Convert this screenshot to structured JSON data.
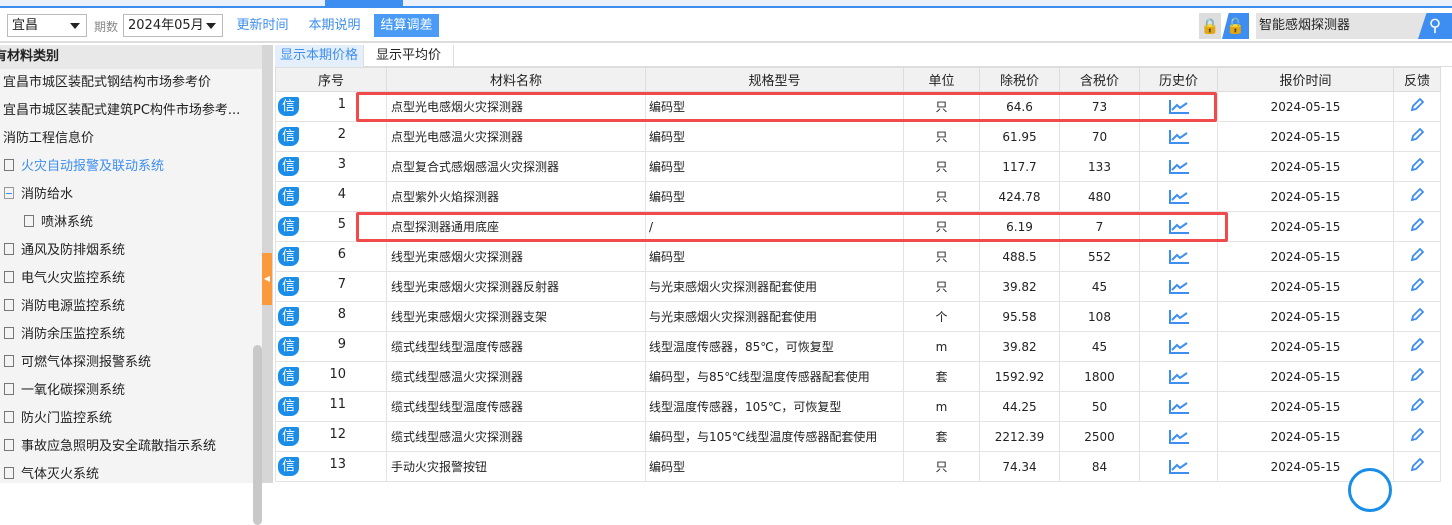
{
  "toolbar": {
    "region": "宜昌",
    "period_label": "期数",
    "period": "2024年05月",
    "buttons": [
      "更新时间",
      "本期说明",
      "结算调差"
    ],
    "search_value": "智能感烟探测器"
  },
  "sidebar": {
    "header": "有材料类别",
    "items": [
      {
        "label": "宜昌市城区装配式钢结构市场参考价",
        "level": 0
      },
      {
        "label": "宜昌市城区装配式建筑PC构件市场参考...",
        "level": 0
      },
      {
        "label": "消防工程信息价",
        "level": 0
      },
      {
        "label": "火灾自动报警及联动系统",
        "level": 1,
        "selected": true
      },
      {
        "label": "消防给水",
        "level": 1,
        "expanded": true
      },
      {
        "label": "喷淋系统",
        "level": 2
      },
      {
        "label": "通风及防排烟系统",
        "level": 1
      },
      {
        "label": "电气火灾监控系统",
        "level": 1
      },
      {
        "label": "消防电源监控系统",
        "level": 1
      },
      {
        "label": "消防余压监控系统",
        "level": 1
      },
      {
        "label": "可燃气体探测报警系统",
        "level": 1
      },
      {
        "label": "一氧化碳探测系统",
        "level": 1
      },
      {
        "label": "防火门监控系统",
        "level": 1
      },
      {
        "label": "事故应急照明及安全疏散指示系统",
        "level": 1
      },
      {
        "label": "气体灭火系统",
        "level": 1
      }
    ]
  },
  "tabs": [
    "显示本期价格",
    "显示平均价"
  ],
  "table": {
    "badge": "信",
    "headers": [
      "序号",
      "材料名称",
      "规格型号",
      "单位",
      "除税价",
      "含税价",
      "历史价",
      "报价时间",
      "反馈"
    ],
    "rows": [
      [
        "1",
        "点型光电感烟火灾探测器",
        "编码型",
        "只",
        "64.6",
        "73",
        "2024-05-15"
      ],
      [
        "2",
        "点型光电感温火灾探测器",
        "编码型",
        "只",
        "61.95",
        "70",
        "2024-05-15"
      ],
      [
        "3",
        "点型复合式感烟感温火灾探测器",
        "编码型",
        "只",
        "117.7",
        "133",
        "2024-05-15"
      ],
      [
        "4",
        "点型紫外火焰探测器",
        "编码型",
        "只",
        "424.78",
        "480",
        "2024-05-15"
      ],
      [
        "5",
        "点型探测器通用底座",
        "/",
        "只",
        "6.19",
        "7",
        "2024-05-15"
      ],
      [
        "6",
        "线型光束感烟火灾探测器",
        "编码型",
        "只",
        "488.5",
        "552",
        "2024-05-15"
      ],
      [
        "7",
        "线型光束感烟火灾探测器反射器",
        "与光束感烟火灾探测器配套使用",
        "只",
        "39.82",
        "45",
        "2024-05-15"
      ],
      [
        "8",
        "线型光束感烟火灾探测器支架",
        "与光束感烟火灾探测器配套使用",
        "个",
        "95.58",
        "108",
        "2024-05-15"
      ],
      [
        "9",
        "缆式线型线型温度传感器",
        "线型温度传感器，85℃，可恢复型",
        "m",
        "39.82",
        "45",
        "2024-05-15"
      ],
      [
        "10",
        "缆式线型感温火灾探测器",
        "编码型，与85℃线型温度传感器配套使用",
        "套",
        "1592.92",
        "1800",
        "2024-05-15"
      ],
      [
        "11",
        "缆式线型线型温度传感器",
        "线型温度传感器，105℃，可恢复型",
        "m",
        "44.25",
        "50",
        "2024-05-15"
      ],
      [
        "12",
        "缆式线型感温火灾探测器",
        "编码型，与105℃线型温度传感器配套使用",
        "套",
        "2212.39",
        "2500",
        "2024-05-15"
      ],
      [
        "13",
        "手动火灾报警按钮",
        "编码型",
        "只",
        "74.34",
        "84",
        "2024-05-15"
      ]
    ]
  },
  "colors": {
    "accent": "#3d8ef0",
    "highlight": "#f04a4a",
    "splitter": "#fb9a3c"
  }
}
